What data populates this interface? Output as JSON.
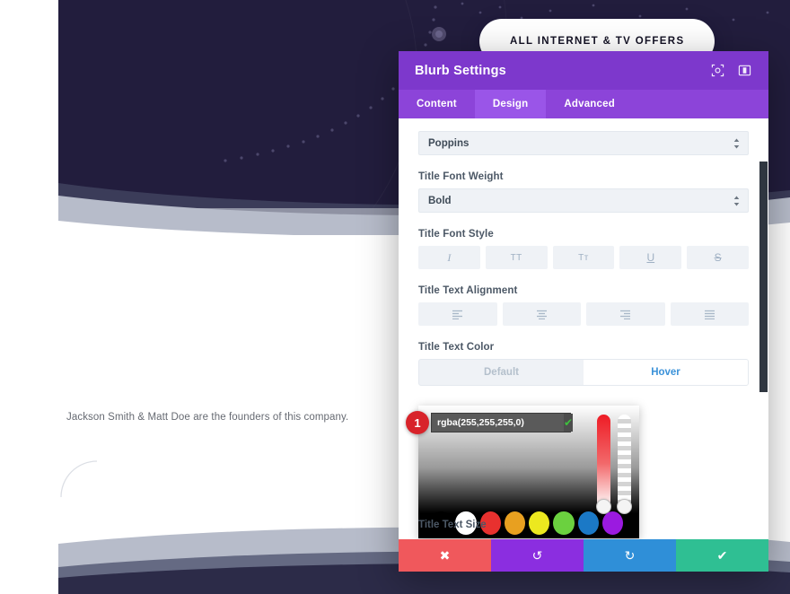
{
  "page": {
    "hero_pill_label": "ALL INTERNET & TV OFFERS",
    "blurb_text": "Jackson Smith & Matt Doe are the founders of this company.",
    "colors": {
      "hero_dark": "#221d3d",
      "wave_gray": "#b7bcca",
      "wave_gray_dark": "#4a4f6b",
      "footer_dark": "#2c2b48"
    }
  },
  "modal": {
    "title": "Blurb Settings",
    "header_icons": [
      {
        "name": "fullscreen-icon",
        "glyph": "⧉"
      },
      {
        "name": "layout-panel-icon",
        "glyph": "▥"
      }
    ],
    "tabs": [
      {
        "label": "Content",
        "active": false
      },
      {
        "label": "Design",
        "active": true
      },
      {
        "label": "Advanced",
        "active": false
      }
    ],
    "fields": {
      "font_family": {
        "label": "",
        "value": "Poppins"
      },
      "font_weight": {
        "label": "Title Font Weight",
        "value": "Bold"
      },
      "font_style": {
        "label": "Title Font Style",
        "options": [
          {
            "name": "italic",
            "glyph": "I"
          },
          {
            "name": "uppercase",
            "glyph": "TT"
          },
          {
            "name": "small-caps",
            "glyph": "Tᴛ"
          },
          {
            "name": "underline",
            "glyph": "U"
          },
          {
            "name": "strikethrough",
            "glyph": "S"
          }
        ]
      },
      "text_alignment": {
        "label": "Title Text Alignment",
        "options": [
          {
            "name": "align-left"
          },
          {
            "name": "align-center"
          },
          {
            "name": "align-right"
          },
          {
            "name": "align-justify"
          }
        ]
      },
      "text_color": {
        "label": "Title Text Color",
        "states": [
          {
            "label": "Default",
            "active": false
          },
          {
            "label": "Hover",
            "active": true
          }
        ]
      },
      "text_size": {
        "label": "Title Text Size"
      }
    },
    "color_picker": {
      "value": "rgba(255,255,255,0)",
      "step_badge": "1",
      "confirm_glyph": "✔",
      "swatches": [
        {
          "name": "swatch-black",
          "hex": "#000000"
        },
        {
          "name": "swatch-white",
          "hex": "#ffffff"
        },
        {
          "name": "swatch-red",
          "hex": "#e8312f"
        },
        {
          "name": "swatch-orange",
          "hex": "#e8a020"
        },
        {
          "name": "swatch-yellow",
          "hex": "#ece81f"
        },
        {
          "name": "swatch-green",
          "hex": "#6bd13f"
        },
        {
          "name": "swatch-blue",
          "hex": "#1b79c6"
        },
        {
          "name": "swatch-purple",
          "hex": "#9b1ae0"
        }
      ]
    },
    "actions": [
      {
        "name": "cancel",
        "glyph": "✖",
        "color": "#f0585c"
      },
      {
        "name": "undo",
        "glyph": "↺",
        "color": "#8b2ee0"
      },
      {
        "name": "redo",
        "glyph": "↻",
        "color": "#2f8fd8"
      },
      {
        "name": "save",
        "glyph": "✔",
        "color": "#2fbf93"
      }
    ]
  }
}
